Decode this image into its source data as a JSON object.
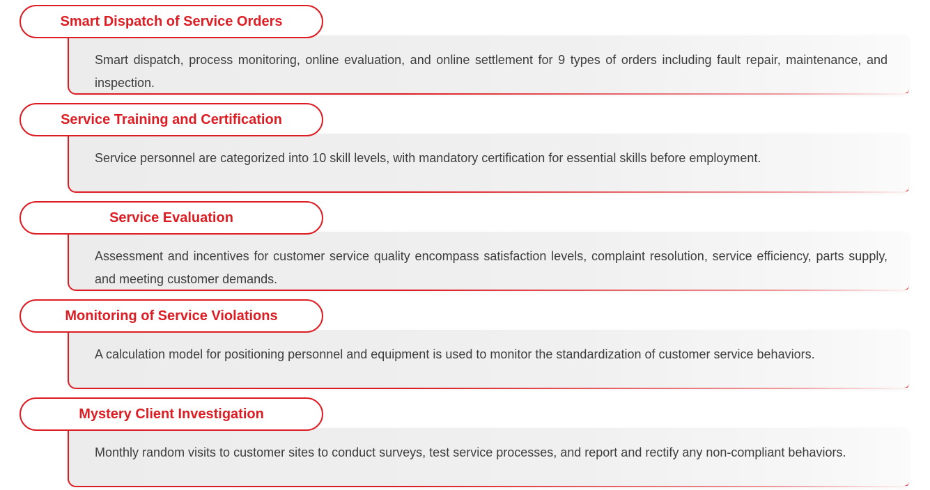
{
  "accent_color": "#dc1d23",
  "items": [
    {
      "title": "Smart Dispatch of Service Orders",
      "description": "Smart dispatch, process monitoring, online evaluation, and online settlement for 9 types of orders including fault repair, maintenance, and inspection."
    },
    {
      "title": "Service Training and Certification",
      "description": "Service personnel are categorized into 10 skill levels, with mandatory certification for essential skills before employment."
    },
    {
      "title": "Service Evaluation",
      "description": "Assessment and incentives for customer service quality encompass satisfaction levels, complaint resolution, service efficiency, parts supply, and meeting customer demands."
    },
    {
      "title": "Monitoring of Service Violations",
      "description": "A calculation model for positioning personnel and equipment is used to monitor the standardization of customer service behaviors."
    },
    {
      "title": "Mystery Client Investigation",
      "description": "Monthly random visits to customer sites to conduct surveys, test service processes, and report and rectify any non-compliant behaviors."
    }
  ]
}
